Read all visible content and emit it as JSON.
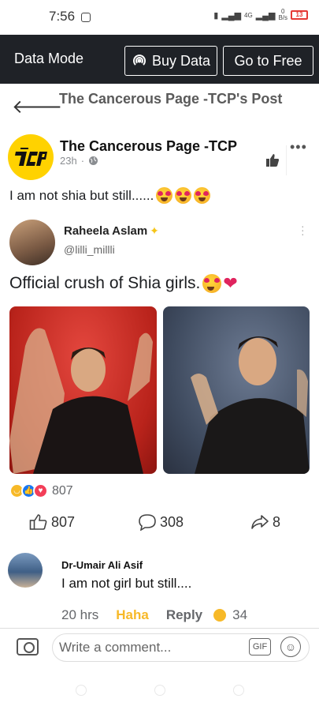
{
  "status_bar": {
    "time": "7:56",
    "network": "4G",
    "speed": "0",
    "speed_unit": "B/s",
    "battery": "13"
  },
  "data_bar": {
    "mode_label": "Data Mode",
    "buy_label": "Buy Data",
    "free_label": "Go to Free"
  },
  "header": {
    "title": "The Cancerous Page -TCP's Post"
  },
  "post": {
    "page_name": "The Cancerous Page -TCP",
    "time": "23h",
    "text": "I am not shia but still......",
    "text_emoji": [
      "heart-eyes",
      "heart-eyes",
      "heart-eyes"
    ]
  },
  "embedded": {
    "name": "Raheela Aslam",
    "handle": "@lilli_millli",
    "text": "Official crush of Shia girls.",
    "photos": [
      "red-background-portrait",
      "gray-background-portrait"
    ]
  },
  "reactions": {
    "types": [
      "haha",
      "like",
      "love"
    ],
    "count": "807"
  },
  "actions": {
    "likes": "807",
    "comments": "308",
    "shares": "8"
  },
  "comment": {
    "author": "Dr-Umair Ali Asif",
    "text": "I am not girl but still....",
    "time": "20 hrs",
    "reaction_label": "Haha",
    "reply_label": "Reply",
    "reaction_count": "34"
  },
  "composer": {
    "placeholder": "Write a comment...",
    "gif_label": "GIF"
  },
  "colors": {
    "fb_blue": "#1877f2",
    "haha_yellow": "#f7b928",
    "love_red": "#f33e58",
    "logo_yellow": "#ffd200",
    "data_bar_bg": "#1f2227"
  }
}
